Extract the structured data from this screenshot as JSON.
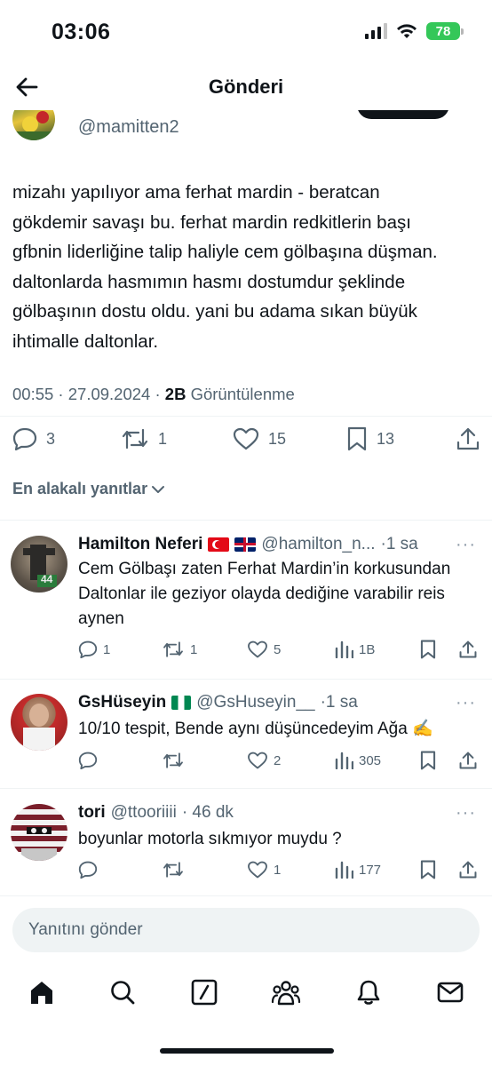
{
  "status_bar": {
    "time": "03:06",
    "battery": "78"
  },
  "header": {
    "title": "Gönderi"
  },
  "tweet": {
    "handle": "@mamitten2",
    "text": "mizahı yapılıyor ama ferhat mardin - beratcan gökdemir savaşı bu. ferhat mardin redkitlerin başı gfbnin liderliğine talip haliyle cem gölbaşına düşman. daltonlarda hasmımın hasmı dostumdur şeklinde gölbaşının dostu oldu. yani bu adama sıkan büyük ihtimalle daltonlar.",
    "time": "00:55 · 27.09.2024 · ",
    "views": "2B",
    "views_label": " Görüntülenme",
    "replies": "3",
    "reposts": "1",
    "likes": "15",
    "bookmarks": "13"
  },
  "filter": {
    "label": "En alakalı yanıtlar"
  },
  "replies": [
    {
      "name": "Hamilton Neferi",
      "handle": "@hamilton_n...",
      "time": "·1 sa",
      "text": "Cem Gölbaşı zaten Ferhat Mardin’in korkusundan Daltonlar ile geziyor olayda dediğine varabilir reis aynen",
      "replies": "1",
      "reposts": "1",
      "likes": "5",
      "views": "1B",
      "avatar_badge": "44"
    },
    {
      "name": "GsHüseyin",
      "handle": "@GsHuseyin__",
      "time": "·1 sa",
      "text": "10/10 tespit, Bende aynı düşüncedeyim Ağa ✍️",
      "replies": "",
      "reposts": "",
      "likes": "2",
      "views": "305"
    },
    {
      "name": "tori",
      "handle": "@ttooriiii",
      "time": "· 46 dk",
      "text": "boyunlar motorla sıkmıyor muydu ?",
      "replies": "",
      "reposts": "",
      "likes": "1",
      "views": "177"
    }
  ],
  "composer": {
    "placeholder": "Yanıtını gönder"
  },
  "icons": {
    "back": "arrow-left-icon",
    "nav": [
      "home-icon",
      "search-icon",
      "grok-icon",
      "communities-icon",
      "notifications-icon",
      "messages-icon"
    ]
  }
}
